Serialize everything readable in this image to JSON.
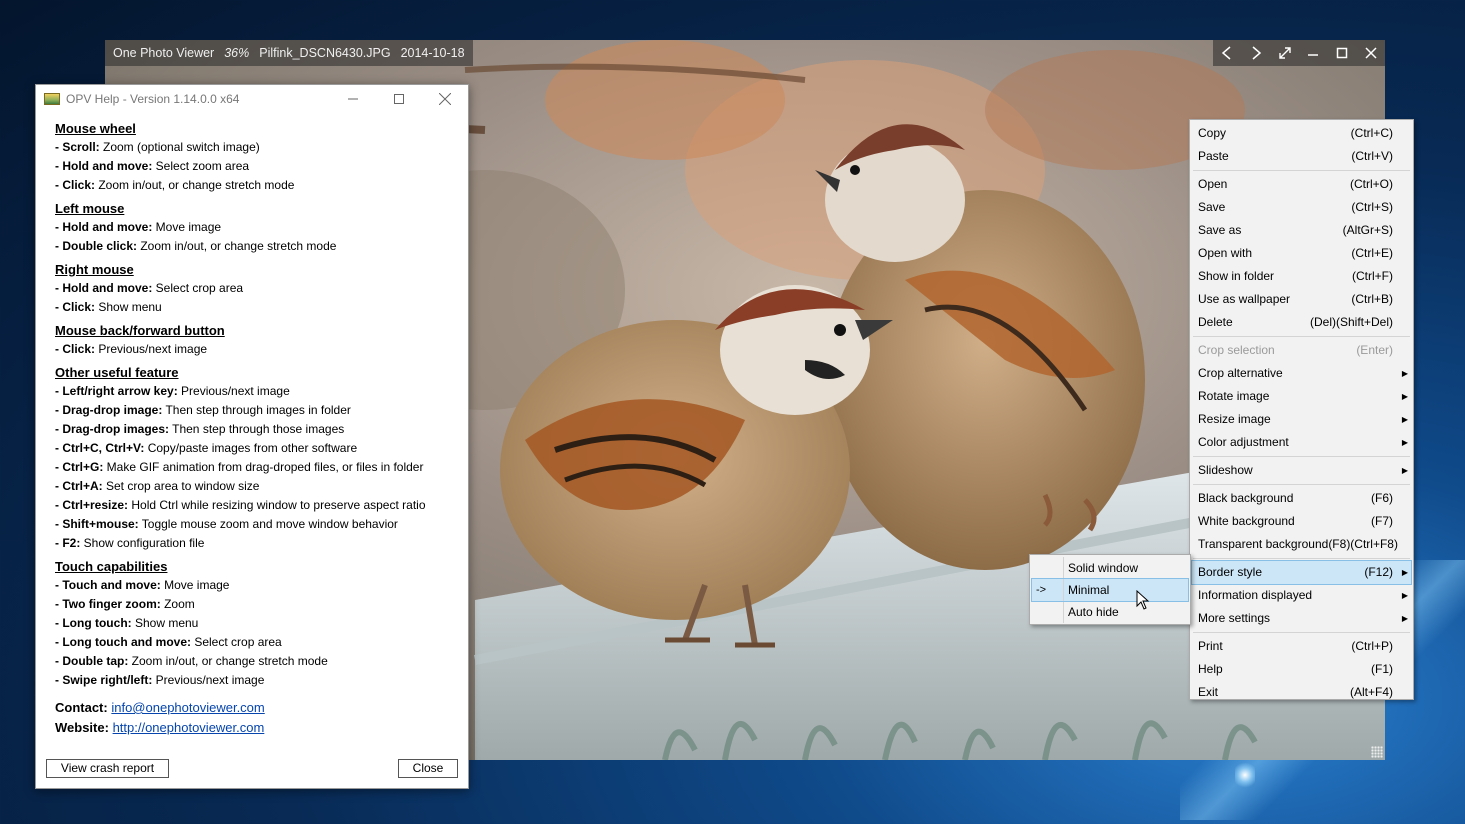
{
  "viewer": {
    "app_name": "One Photo Viewer",
    "zoom": "36%",
    "filename": "Pilfink_DSCN6430.JPG",
    "date": "2014-10-18",
    "controls": [
      "prev-icon",
      "next-icon",
      "fullscreen-icon",
      "minimize-icon",
      "maximize-icon",
      "close-icon"
    ]
  },
  "help": {
    "title": "OPV Help - Version 1.14.0.0 x64",
    "sections": [
      {
        "heading": "Mouse wheel",
        "lines": [
          {
            "key": "- Scroll:",
            "text": " Zoom (optional switch image)"
          },
          {
            "key": "- Hold and move:",
            "text": " Select zoom area"
          },
          {
            "key": "- Click:",
            "text": " Zoom in/out, or change stretch mode"
          }
        ]
      },
      {
        "heading": "Left mouse",
        "lines": [
          {
            "key": "- Hold and move:",
            "text": " Move image"
          },
          {
            "key": "- Double click:",
            "text": " Zoom in/out, or change stretch mode"
          }
        ]
      },
      {
        "heading": "Right mouse",
        "lines": [
          {
            "key": "- Hold and move:",
            "text": " Select crop area"
          },
          {
            "key": "- Click:",
            "text": " Show menu"
          }
        ]
      },
      {
        "heading": "Mouse back/forward button",
        "lines": [
          {
            "key": "- Click:",
            "text": " Previous/next image"
          }
        ]
      },
      {
        "heading": "Other useful feature",
        "lines": [
          {
            "key": "- Left/right arrow key:",
            "text": " Previous/next image"
          },
          {
            "key": "- Drag-drop image:",
            "text": " Then step through images in folder"
          },
          {
            "key": "- Drag-drop images:",
            "text": " Then step through those images"
          },
          {
            "key": "- Ctrl+C, Ctrl+V:",
            "text": " Copy/paste images from other software"
          },
          {
            "key": "- Ctrl+G:",
            "text": " Make GIF animation from drag-droped files, or files in folder"
          },
          {
            "key": "- Ctrl+A:",
            "text": " Set crop area to window size"
          },
          {
            "key": "- Ctrl+resize:",
            "text": " Hold Ctrl while resizing window to preserve aspect ratio"
          },
          {
            "key": "- Shift+mouse:",
            "text": " Toggle mouse zoom and move window behavior"
          },
          {
            "key": "- F2:",
            "text": " Show configuration file"
          }
        ]
      },
      {
        "heading": "Touch capabilities",
        "lines": [
          {
            "key": "- Touch and move:",
            "text": " Move image"
          },
          {
            "key": "- Two finger zoom:",
            "text": " Zoom"
          },
          {
            "key": "- Long touch:",
            "text": " Show menu"
          },
          {
            "key": "- Long touch and move:",
            "text": " Select crop area"
          },
          {
            "key": "- Double tap:",
            "text": " Zoom in/out, or change stretch mode"
          },
          {
            "key": "- Swipe right/left:",
            "text": " Previous/next image"
          }
        ]
      }
    ],
    "contact_label": "Contact:",
    "contact_email": "info@onephotoviewer.com",
    "website_label": "Website:",
    "website_url": "http://onephotoviewer.com",
    "crash_button": "View crash report",
    "close_button": "Close"
  },
  "menu": [
    {
      "label": "Copy",
      "shortcut": "(Ctrl+C)"
    },
    {
      "label": "Paste",
      "shortcut": "(Ctrl+V)"
    },
    {
      "sep": true
    },
    {
      "label": "Open",
      "shortcut": "(Ctrl+O)"
    },
    {
      "label": "Save",
      "shortcut": "(Ctrl+S)"
    },
    {
      "label": "Save as",
      "shortcut": "(AltGr+S)"
    },
    {
      "label": "Open with",
      "shortcut": "(Ctrl+E)"
    },
    {
      "label": "Show in folder",
      "shortcut": "(Ctrl+F)"
    },
    {
      "label": "Use as wallpaper",
      "shortcut": "(Ctrl+B)"
    },
    {
      "label": "Delete",
      "shortcut": "(Del)(Shift+Del)"
    },
    {
      "sep": true
    },
    {
      "label": "Crop selection",
      "shortcut": "(Enter)",
      "disabled": true
    },
    {
      "label": "Crop alternative",
      "submenu": true
    },
    {
      "label": "Rotate image",
      "submenu": true
    },
    {
      "label": "Resize image",
      "submenu": true
    },
    {
      "label": "Color adjustment",
      "submenu": true
    },
    {
      "sep": true
    },
    {
      "label": "Slideshow",
      "submenu": true
    },
    {
      "sep": true
    },
    {
      "label": "Black background",
      "shortcut": "(F6)"
    },
    {
      "label": "White background",
      "shortcut": "(F7)"
    },
    {
      "label": "Transparent background",
      "shortcut": "(F8)(Ctrl+F8)"
    },
    {
      "sep": true
    },
    {
      "label": "Border style",
      "shortcut": "(F12)",
      "submenu": true,
      "highlighted": true
    },
    {
      "label": "Information displayed",
      "submenu": true
    },
    {
      "label": "More settings",
      "submenu": true
    },
    {
      "sep": true
    },
    {
      "label": "Print",
      "shortcut": "(Ctrl+P)"
    },
    {
      "label": "Help",
      "shortcut": "(F1)"
    },
    {
      "label": "Exit",
      "shortcut": "(Alt+F4)"
    }
  ],
  "submenu": [
    {
      "label": "Solid window",
      "check": ""
    },
    {
      "label": "Minimal",
      "check": "->",
      "highlighted": true
    },
    {
      "label": "Auto hide",
      "check": ""
    }
  ]
}
